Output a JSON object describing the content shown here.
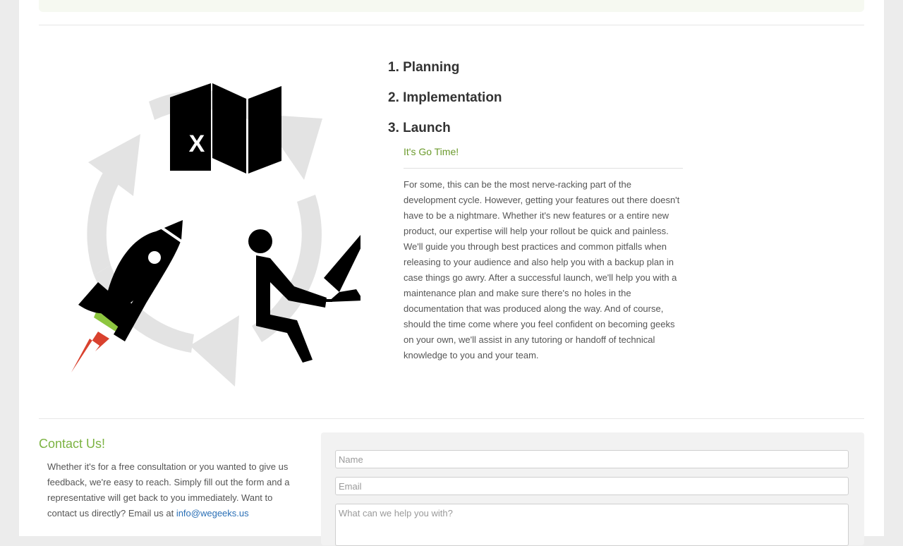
{
  "process": {
    "steps": [
      {
        "label": "1. Planning"
      },
      {
        "label": "2. Implementation"
      },
      {
        "label": "3. Launch"
      }
    ],
    "active": {
      "subtitle": "It's Go Time!",
      "body": "For some, this can be the most nerve-racking part of the development cycle. However, getting your features out there doesn't have to be a nightmare. Whether it's new features or a entire new product, our expertise will help your rollout be quick and painless. We'll guide you through best practices and common pitfalls when releasing to your audience and also help you with a backup plan in case things go awry. After a successful launch, we'll help you with a maintenance plan and make sure there's no holes in the documentation that was produced along the way. And of course, should the time come where you feel confident on becoming geeks on your own, we'll assist in any tutoring or handoff of technical knowledge to you and your team."
    },
    "illustration": {
      "map_mark": "X",
      "icons": [
        "map-icon",
        "rocket-icon",
        "developer-at-computer-icon",
        "cycle-arrows-icon"
      ],
      "colors": {
        "arrows": "#e3e3e3",
        "flame": "#d9412e",
        "band": "#8dc63f",
        "ink": "#000000"
      }
    }
  },
  "contact": {
    "title": "Contact Us!",
    "text": "Whether it's for a free consultation or you wanted to give us feedback, we're easy to reach. Simply fill out the form and a representative will get back to you immediately. Want to contact us directly? Email us at ",
    "email": "info@wegeeks.us",
    "form": {
      "name_placeholder": "Name",
      "email_placeholder": "Email",
      "message_placeholder": "What can we help you with?"
    }
  },
  "colors": {
    "accent_green": "#7cb342",
    "link_blue": "#2a6fb6",
    "heading": "#333333"
  }
}
